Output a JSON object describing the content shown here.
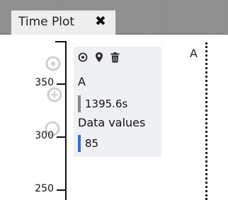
{
  "tab": {
    "title": "Time Plot",
    "close_glyph": "✖"
  },
  "axis": {
    "ticks": [
      {
        "label": "350"
      },
      {
        "label": "300"
      },
      {
        "label": "250"
      }
    ]
  },
  "plot": {
    "right_series_label": "A"
  },
  "readout": {
    "icons": [
      "target-icon",
      "map-pin-icon",
      "trash-icon"
    ],
    "series_name": "A",
    "time_value": "1395.6s",
    "data_label": "Data values",
    "data_value": "85",
    "colors": {
      "time_bar": "#888888",
      "data_bar": "#2f6fe0"
    }
  }
}
